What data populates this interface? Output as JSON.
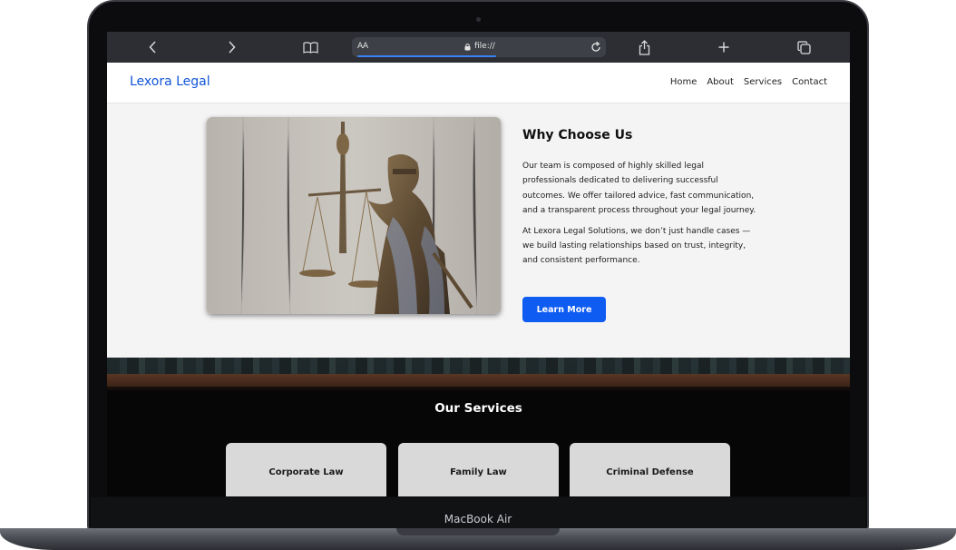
{
  "device": {
    "label": "MacBook Air"
  },
  "browser": {
    "text_size_label": "AA",
    "address": "file://",
    "load_progress": 0.57
  },
  "site": {
    "logo": "Lexora Legal",
    "nav": [
      "Home",
      "About",
      "Services",
      "Contact"
    ],
    "why": {
      "title": "Why Choose Us",
      "paragraph1": "Our team is composed of highly skilled legal professionals dedicated to delivering successful outcomes. We offer tailored advice, fast communication, and a transparent process throughout your legal journey.",
      "paragraph2": "At Lexora Legal Solutions, we don’t just handle cases — we build lasting relationships based on trust, integrity, and consistent performance.",
      "button": "Learn More"
    },
    "services": {
      "title": "Our Services",
      "cards": [
        "Corporate Law",
        "Family Law",
        "Criminal Defense"
      ]
    }
  },
  "colors": {
    "accent": "#0f5cf2",
    "logo": "#1256d8",
    "toolbar": "#2c2e33"
  },
  "icons": [
    "back-icon",
    "forward-icon",
    "bookmarks-icon",
    "lock-icon",
    "reload-icon",
    "share-icon",
    "new-tab-icon",
    "tabs-icon"
  ]
}
